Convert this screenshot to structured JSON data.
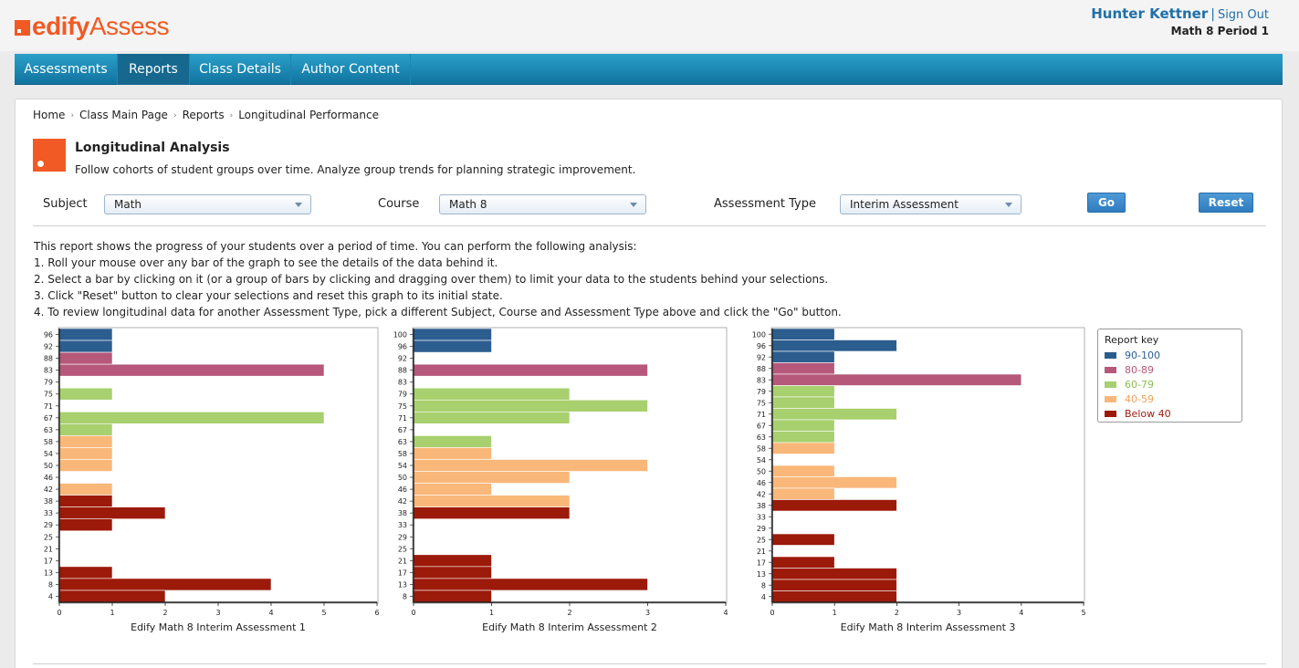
{
  "brand": {
    "logo_part1": "edify",
    "logo_part2": "Assess"
  },
  "user": {
    "name": "Hunter Kettner",
    "separator": "|",
    "signout": "Sign Out",
    "class_name": "Math 8 Period 1"
  },
  "nav": {
    "tabs": [
      {
        "label": "Assessments",
        "active": false
      },
      {
        "label": "Reports",
        "active": true
      },
      {
        "label": "Class Details",
        "active": false
      },
      {
        "label": "Author Content",
        "active": false
      }
    ]
  },
  "breadcrumb": {
    "items": [
      "Home",
      "Class Main Page",
      "Reports"
    ],
    "current": "Longitudinal Performance",
    "sep": "›"
  },
  "header": {
    "title": "Longitudinal Analysis",
    "description": "Follow cohorts of student groups over time. Analyze group trends for planning strategic improvement."
  },
  "filters": {
    "subject_label": "Subject",
    "subject_value": "Math",
    "course_label": "Course",
    "course_value": "Math 8",
    "type_label": "Assessment Type",
    "type_value": "Interim Assessment",
    "go_label": "Go",
    "reset_label": "Reset"
  },
  "instructions": [
    "This report shows the progress of your students over a period of time. You can perform the following analysis:",
    "1. Roll your mouse over any bar of the graph to see the details of the data behind it.",
    "2. Select a bar by clicking on it (or a group of bars by clicking and dragging over them) to limit your data to the students behind your selections.",
    "3. Click \"Reset\" button to clear your selections and reset this graph to its initial state.",
    "4. To review longitudinal data for another Assessment Type, pick a different Subject, Course and Assessment Type above and click the \"Go\" button."
  ],
  "legend": {
    "title": "Report key",
    "items": [
      {
        "label": "90-100",
        "color": "#2c5d8f",
        "text_color": "#2c5d8f"
      },
      {
        "label": "80-89",
        "color": "#b5587a",
        "text_color": "#b5587a"
      },
      {
        "label": "60-79",
        "color": "#a8d06e",
        "text_color": "#8cbf4e"
      },
      {
        "label": "40-59",
        "color": "#f9b779",
        "text_color": "#f0a05a"
      },
      {
        "label": "Below 40",
        "color": "#9c1a0a",
        "text_color": "#9c1a0a"
      }
    ]
  },
  "chart_data": [
    {
      "type": "bar",
      "orientation": "horizontal",
      "title": "Edify Math 8 Interim Assessment 1",
      "xlim": [
        0,
        6
      ],
      "xticks": [
        "0",
        "1",
        "2",
        "3",
        "4",
        "5",
        "6"
      ],
      "categories": [
        "96",
        "92",
        "88",
        "83",
        "79",
        "75",
        "71",
        "67",
        "63",
        "58",
        "54",
        "50",
        "46",
        "42",
        "38",
        "33",
        "29",
        "25",
        "21",
        "17",
        "13",
        "8",
        "4"
      ],
      "values": [
        1,
        1,
        1,
        5,
        0,
        1,
        0,
        5,
        1,
        1,
        1,
        1,
        0,
        1,
        1,
        2,
        1,
        0,
        0,
        0,
        1,
        4,
        2
      ],
      "bands": [
        "90-100",
        "90-100",
        "80-89",
        "80-89",
        "60-79",
        "60-79",
        "60-79",
        "60-79",
        "60-79",
        "40-59",
        "40-59",
        "40-59",
        "40-59",
        "40-59",
        "Below 40",
        "Below 40",
        "Below 40",
        "Below 40",
        "Below 40",
        "Below 40",
        "Below 40",
        "Below 40",
        "Below 40"
      ]
    },
    {
      "type": "bar",
      "orientation": "horizontal",
      "title": "Edify Math 8 Interim Assessment 2",
      "xlim": [
        0,
        4
      ],
      "xticks": [
        "0",
        "1",
        "2",
        "3",
        "4"
      ],
      "categories": [
        "100",
        "96",
        "92",
        "88",
        "83",
        "79",
        "75",
        "71",
        "67",
        "63",
        "58",
        "54",
        "50",
        "46",
        "42",
        "38",
        "33",
        "29",
        "25",
        "21",
        "17",
        "13",
        "8"
      ],
      "values": [
        1,
        1,
        0,
        3,
        0,
        2,
        3,
        2,
        0,
        1,
        1,
        3,
        2,
        1,
        2,
        2,
        0,
        0,
        0,
        1,
        1,
        3,
        1
      ],
      "bands": [
        "90-100",
        "90-100",
        "90-100",
        "80-89",
        "80-89",
        "60-79",
        "60-79",
        "60-79",
        "60-79",
        "60-79",
        "40-59",
        "40-59",
        "40-59",
        "40-59",
        "40-59",
        "Below 40",
        "Below 40",
        "Below 40",
        "Below 40",
        "Below 40",
        "Below 40",
        "Below 40",
        "Below 40"
      ]
    },
    {
      "type": "bar",
      "orientation": "horizontal",
      "title": "Edify Math 8 Interim Assessment 3",
      "xlim": [
        0,
        5
      ],
      "xticks": [
        "0",
        "1",
        "2",
        "3",
        "4",
        "5"
      ],
      "categories": [
        "100",
        "96",
        "92",
        "88",
        "83",
        "79",
        "75",
        "71",
        "67",
        "63",
        "58",
        "54",
        "50",
        "46",
        "42",
        "38",
        "33",
        "29",
        "25",
        "21",
        "17",
        "13",
        "8",
        "4"
      ],
      "values": [
        1,
        2,
        1,
        1,
        4,
        1,
        1,
        2,
        1,
        1,
        1,
        0,
        1,
        2,
        1,
        2,
        0,
        0,
        1,
        0,
        1,
        2,
        2,
        2
      ],
      "bands": [
        "90-100",
        "90-100",
        "90-100",
        "80-89",
        "80-89",
        "60-79",
        "60-79",
        "60-79",
        "60-79",
        "60-79",
        "40-59",
        "40-59",
        "40-59",
        "40-59",
        "40-59",
        "Below 40",
        "Below 40",
        "Below 40",
        "Below 40",
        "Below 40",
        "Below 40",
        "Below 40",
        "Below 40",
        "Below 40"
      ]
    }
  ]
}
